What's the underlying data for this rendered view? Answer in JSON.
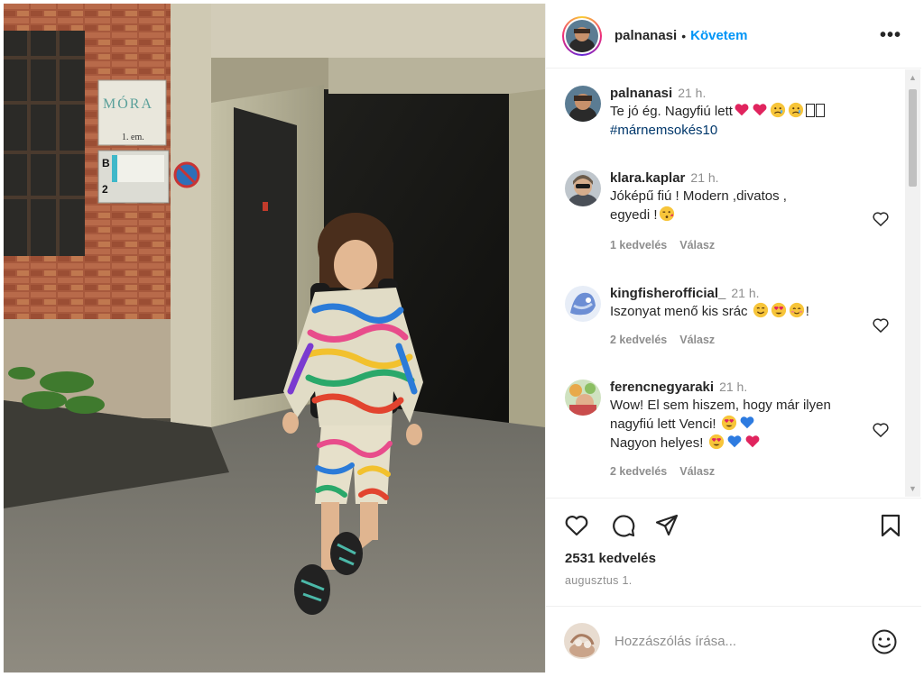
{
  "post": {
    "author": "palnanasi",
    "separator": "•",
    "follow_label": "Követem",
    "more_label": "•••"
  },
  "comments": [
    {
      "user": "palnanasi",
      "time": "21 h.",
      "text": "Te jó ég. Nagyfiú lett",
      "emoji": [
        "red-heart",
        "red-heart",
        "sad-face",
        "sad-face"
      ],
      "hashtag": "#márnemsokés10"
    },
    {
      "user": "klara.kaplar",
      "time": "21 h.",
      "text": "Jóképű fiú ! Modern ,divatos , egyedi !",
      "emoji": [
        "kissing-face"
      ],
      "likes": "1 kedvelés",
      "reply": "Válasz"
    },
    {
      "user": "kingfisherofficial_",
      "time": "21 h.",
      "text": "Iszonyat menő kis srác",
      "emoji": [
        "smiling-face",
        "heart-eyes-face",
        "blush-face"
      ],
      "suffix": "!",
      "likes": "2 kedvelés",
      "reply": "Válasz"
    },
    {
      "user": "ferencnegyaraki",
      "time": "21 h.",
      "text": "Wow! El sem hiszem, hogy már ilyen nagyfiú lett Venci!",
      "text2": "Nagyon helyes!",
      "emoji": [
        "heart-eyes-face",
        "blue-heart",
        "heart-eyes-face",
        "blue-heart",
        "red-heart"
      ],
      "likes": "2 kedvelés",
      "reply": "Válasz"
    }
  ],
  "actions": {
    "icons": [
      "heart-icon",
      "comment-icon",
      "share-icon",
      "bookmark-icon"
    ],
    "likes": "2531 kedvelés",
    "date": "augusztus 1."
  },
  "composer": {
    "placeholder": "Hozzászólás írása...",
    "icon": "emoji-icon"
  },
  "photo": {
    "signs": [
      "MÓRA",
      "1. em.",
      "B",
      "2"
    ]
  },
  "colors": {
    "link": "#0095f6",
    "hashtag": "#00376b",
    "muted": "#8e8e8e"
  }
}
